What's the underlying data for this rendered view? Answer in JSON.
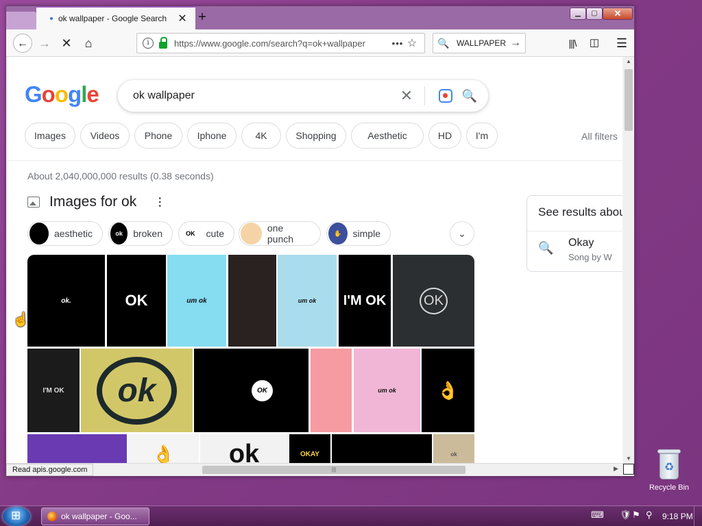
{
  "browser": {
    "tab_title": "ok wallpaper - Google Search",
    "url": "https://www.google.com/search?q=ok+wallpaper",
    "search_box": "WALLPAPER",
    "status_text": "Read apis.google.com"
  },
  "google": {
    "logo": [
      "G",
      "o",
      "o",
      "g",
      "l",
      "e"
    ],
    "query": "ok wallpaper",
    "filter_chips": [
      "Images",
      "Videos",
      "Phone",
      "Iphone",
      "4K",
      "Shopping",
      "Aesthetic",
      "HD",
      "I'm"
    ],
    "all_filters": "All filters",
    "result_stats": "About 2,040,000,000 results (0.38 seconds)",
    "images_heading": "Images for ok",
    "sub_chips": [
      "aesthetic",
      "broken",
      "cute",
      "one punch",
      "simple"
    ],
    "panel": {
      "title": "See results about",
      "item_title": "Okay",
      "item_sub": "Song by W"
    },
    "tiles": [
      {
        "text": "ok.",
        "bg": "#000000",
        "fg": "#ffffff"
      },
      {
        "text": "OK",
        "bg": "#000000",
        "fg": "#ffffff"
      },
      {
        "text": "um ok",
        "bg": "#86dcf0",
        "fg": "#111111"
      },
      {
        "text": "",
        "bg": "#2a2220",
        "fg": "#bbbbbb"
      },
      {
        "text": "um ok",
        "bg": "#a9dced",
        "fg": "#111111"
      },
      {
        "text": "I'M OK",
        "bg": "#000000",
        "fg": "#ffffff"
      },
      {
        "text": "OK",
        "bg": "#2b2f31",
        "fg": "#d9d9d9"
      },
      {
        "text": "I'M OK",
        "bg": "#1b1b1b",
        "fg": "#dddddd"
      },
      {
        "text": "ok",
        "bg": "#d2c768",
        "fg": "#1d2a2c"
      },
      {
        "text": "OK",
        "bg": "#000000",
        "fg": "#000000"
      },
      {
        "text": "",
        "bg": "#f59ba1",
        "fg": "#333333"
      },
      {
        "text": "um ok",
        "bg": "#f1b6d6",
        "fg": "#111111"
      },
      {
        "text": "👌",
        "bg": "#000000",
        "fg": "#f2b533"
      },
      {
        "text": "",
        "bg": "#6a3ab3",
        "fg": "#ffffff"
      },
      {
        "text": "👌",
        "bg": "#f4f4f4",
        "fg": "#e8a079"
      },
      {
        "text": "ok",
        "bg": "#f2f2f2",
        "fg": "#111111"
      },
      {
        "text": "OKAY",
        "bg": "#000000",
        "fg": "#ffd34a"
      },
      {
        "text": "",
        "bg": "#000000",
        "fg": "#e23b2e"
      },
      {
        "text": "ok",
        "bg": "#cbbb9b",
        "fg": "#555555"
      }
    ]
  },
  "taskbar": {
    "task_label": "ok wallpaper - Goo...",
    "clock": "9:18 PM"
  },
  "desktop": {
    "recycle_bin": "Recycle Bin"
  }
}
